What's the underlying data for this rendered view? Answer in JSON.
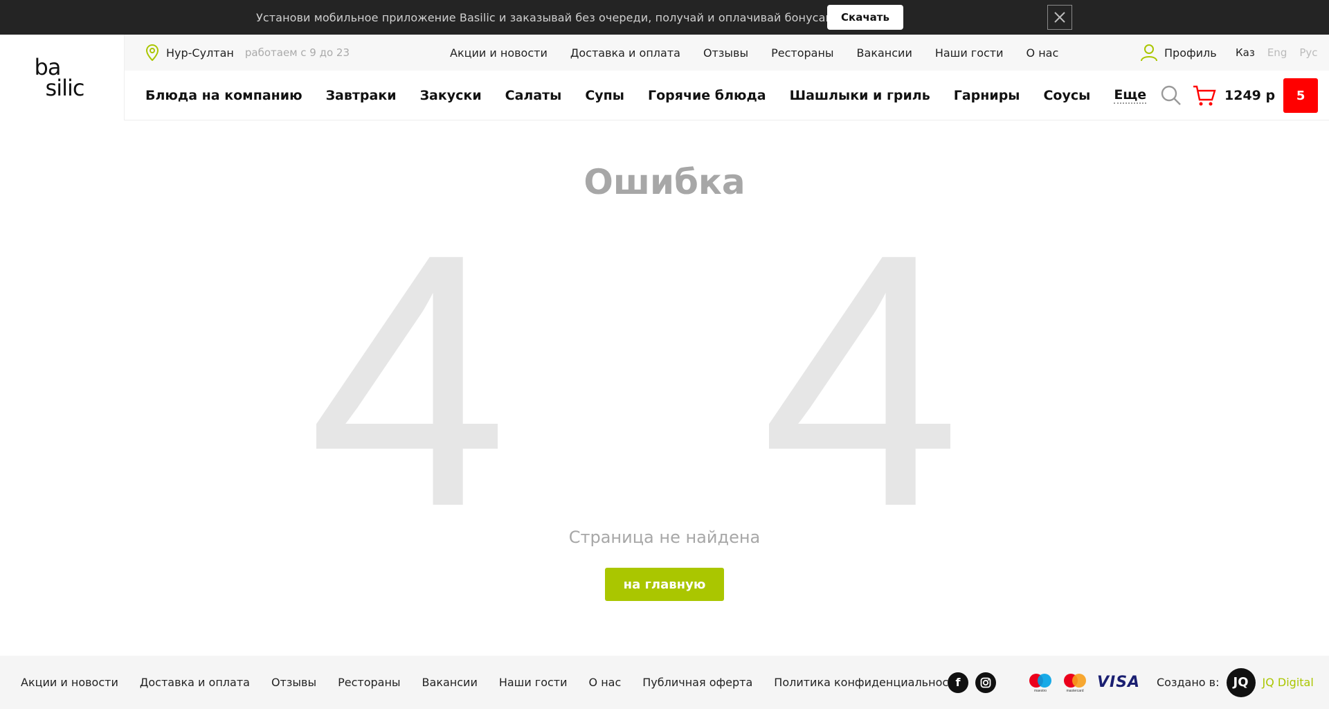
{
  "banner": {
    "text": "Установи мобильное приложение Basilic и заказывай без очереди, получай и оплачивай бонусами!",
    "download_label": "Скачать",
    "close_icon": "close-icon"
  },
  "logo": {
    "line1": "ba",
    "line2": "silic"
  },
  "subheader": {
    "city": "Нур-Султан",
    "hours": "работаем с 9 до 23",
    "nav": [
      "Акции и новости",
      "Доставка и оплата",
      "Отзывы",
      "Рестораны",
      "Вакансии",
      "Наши гости",
      "О нас"
    ],
    "profile_label": "Профиль",
    "languages": [
      "Каз",
      "Eng",
      "Рус"
    ]
  },
  "categories": [
    "Блюда на компанию",
    "Завтраки",
    "Закуски",
    "Салаты",
    "Супы",
    "Горячие блюда",
    "Шашлыки и гриль",
    "Гарниры",
    "Соусы",
    "Еще"
  ],
  "cart": {
    "total": "1249 р",
    "count": "5"
  },
  "error": {
    "title": "Ошибка",
    "digit_left": "4",
    "digit_right": "4",
    "subtitle": "Страница не найдена",
    "home_button": "на главную"
  },
  "footer": {
    "nav": [
      "Акции и новости",
      "Доставка и оплата",
      "Отзывы",
      "Рестораны",
      "Вакансии",
      "Наши гости",
      "О нас",
      "Публичная оферта",
      "Политика конфиденциальности"
    ],
    "social": [
      "facebook-icon",
      "instagram-icon"
    ],
    "payments": [
      "maestro-icon",
      "mastercard-icon",
      "VISA"
    ],
    "created_by_label": "Создано в:",
    "creator_logo": "JQ",
    "creator_name": "JQ Digital"
  },
  "colors": {
    "accent": "#aac600",
    "cart_badge": "#ff0000",
    "banner_bg": "#242424"
  }
}
